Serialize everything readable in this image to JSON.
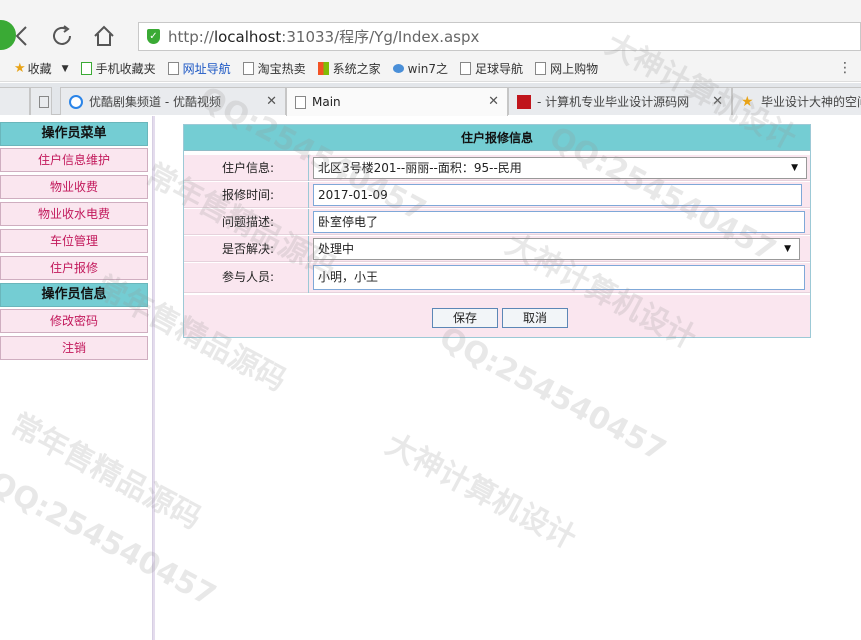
{
  "browser": {
    "url_prefix": "http://",
    "url_host": "localhost",
    "url_rest": ":31033/程序/Yg/Index.aspx",
    "bookmarks": [
      {
        "label": "收藏",
        "icon": "star-icon"
      },
      {
        "label": "手机收藏夹",
        "icon": "phone-icon"
      },
      {
        "label": "网址导航",
        "icon": "page-icon"
      },
      {
        "label": "淘宝热卖",
        "icon": "page-icon"
      },
      {
        "label": "系统之家",
        "icon": "windows-icon"
      },
      {
        "label": "win7之",
        "icon": "cloud-icon"
      },
      {
        "label": "足球导航",
        "icon": "page-icon"
      },
      {
        "label": "网上购物",
        "icon": "page-icon"
      }
    ],
    "tabs": [
      {
        "label": "优酷剧集频道 - 优酷视频"
      },
      {
        "label": "Main"
      },
      {
        "label": "- 计算机专业毕业设计源码网"
      },
      {
        "label": "毕业设计大神的空间"
      }
    ]
  },
  "sidebar": {
    "sections": [
      {
        "title": "操作员菜单",
        "items": [
          "住户信息维护",
          "物业收费",
          "物业收水电费",
          "车位管理",
          "住户报修"
        ]
      },
      {
        "title": "操作员信息",
        "items": [
          "修改密码",
          "注销"
        ]
      }
    ]
  },
  "form": {
    "title": "住户报修信息",
    "rows": [
      {
        "label": "住户信息:",
        "value": "北区3号楼201--丽丽--面积：95--民用",
        "type": "select"
      },
      {
        "label": "报修时间:",
        "value": "2017-01-09",
        "type": "input"
      },
      {
        "label": "问题描述:",
        "value": "卧室停电了",
        "type": "input"
      },
      {
        "label": "是否解决:",
        "value": "处理中",
        "type": "select"
      },
      {
        "label": "参与人员:",
        "value": "小明，小王",
        "type": "input"
      }
    ],
    "save_label": "保存",
    "cancel_label": "取消"
  },
  "watermarks": [
    "QQ:254540457",
    "大神计算机设计",
    "常年售精品源码",
    "QQ:254540457",
    "大神计算机设计",
    "常年售精品源码",
    "QQ:254540457",
    "常年售精品源码",
    "QQ:254540457",
    "大神计算机设计"
  ]
}
